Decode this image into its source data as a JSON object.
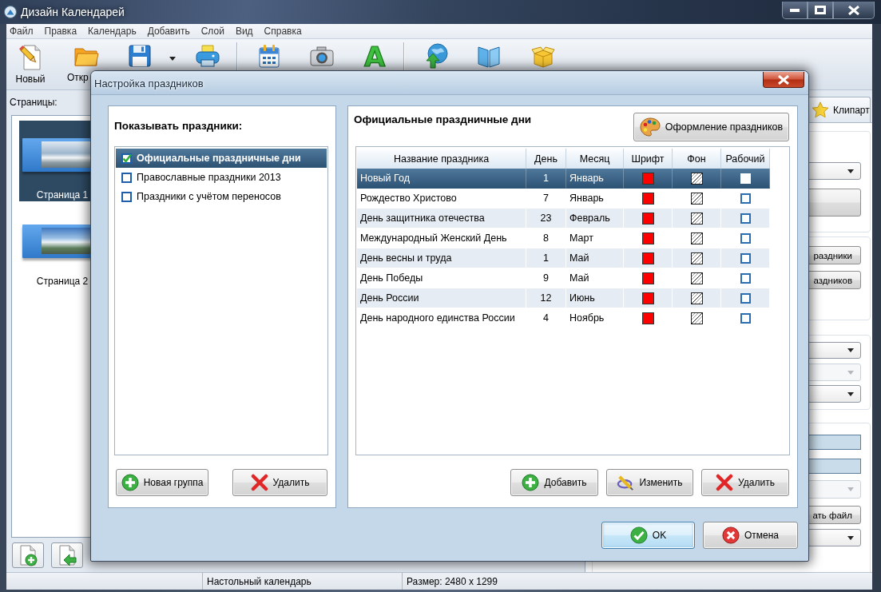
{
  "window": {
    "title": "Дизайн Календарей"
  },
  "menu": [
    "Файл",
    "Правка",
    "Календарь",
    "Добавить",
    "Слой",
    "Вид",
    "Справка"
  ],
  "toolbar": {
    "new_label": "Новый",
    "open_label": "Откр",
    "text_glyph": "A"
  },
  "sidebar": {
    "label": "Страницы:",
    "pages": [
      {
        "label": "Страница 1",
        "selected": true
      },
      {
        "label": "Страница 2",
        "selected": false
      }
    ]
  },
  "right_panel": {
    "tab": "Клипарт",
    "groups": [
      {
        "controls": [
          {
            "kind": "dropdown",
            "disabled": false
          },
          {
            "kind": "button",
            "disabled": false
          }
        ]
      },
      {
        "controls": [
          {
            "kind": "button",
            "label": "раздники",
            "disabled": false
          },
          {
            "kind": "button",
            "label": "аздников",
            "disabled": false
          }
        ]
      },
      {
        "controls": [
          {
            "kind": "dropdown",
            "disabled": false
          },
          {
            "kind": "dropdown",
            "disabled": true
          },
          {
            "kind": "dropdown",
            "disabled": false
          }
        ]
      },
      {
        "controls": [
          {
            "kind": "field",
            "disabled": false
          },
          {
            "kind": "field",
            "disabled": false
          },
          {
            "kind": "dropdown",
            "disabled": true
          },
          {
            "kind": "button",
            "label": "ать файл",
            "disabled": false
          },
          {
            "kind": "dropdown",
            "disabled": false
          }
        ]
      }
    ]
  },
  "dialog": {
    "title": "Настройка праздников",
    "groups_panel": {
      "heading": "Показывать праздники:",
      "items": [
        {
          "label": "Официальные праздничные дни",
          "checked": true,
          "selected": true
        },
        {
          "label": "Православные праздники 2013",
          "checked": false,
          "selected": false
        },
        {
          "label": "Праздники с учётом переносов",
          "checked": false,
          "selected": false
        }
      ],
      "buttons": [
        "Новая группа",
        "Удалить"
      ]
    },
    "holidays_panel": {
      "heading": "Официальные праздничные дни",
      "style_button": "Оформление праздников",
      "columns": [
        "Название праздника",
        "День",
        "Месяц",
        "Шрифт",
        "Фон",
        "Рабочий"
      ],
      "rows": [
        {
          "name": "Новый Год",
          "day": "1",
          "month": "Январь",
          "working": false,
          "selected": true
        },
        {
          "name": "Рождество Христово",
          "day": "7",
          "month": "Январь",
          "working": false,
          "selected": false
        },
        {
          "name": "День защитника отечества",
          "day": "23",
          "month": "Февраль",
          "working": false,
          "selected": false
        },
        {
          "name": "Международный Женский День",
          "day": "8",
          "month": "Март",
          "working": false,
          "selected": false
        },
        {
          "name": "День весны и труда",
          "day": "1",
          "month": "Май",
          "working": false,
          "selected": false
        },
        {
          "name": "День Победы",
          "day": "9",
          "month": "Май",
          "working": false,
          "selected": false
        },
        {
          "name": "День России",
          "day": "12",
          "month": "Июнь",
          "working": false,
          "selected": false
        },
        {
          "name": "День народного единства России",
          "day": "4",
          "month": "Ноябрь",
          "working": false,
          "selected": false
        }
      ],
      "buttons": [
        "Добавить",
        "Изменить",
        "Удалить"
      ]
    },
    "buttons": [
      {
        "label": "OK",
        "default": true
      },
      {
        "label": "Отмена",
        "default": false
      }
    ]
  },
  "status_bar": [
    "Настольный календарь",
    "Размер: 2480 x 1299"
  ]
}
